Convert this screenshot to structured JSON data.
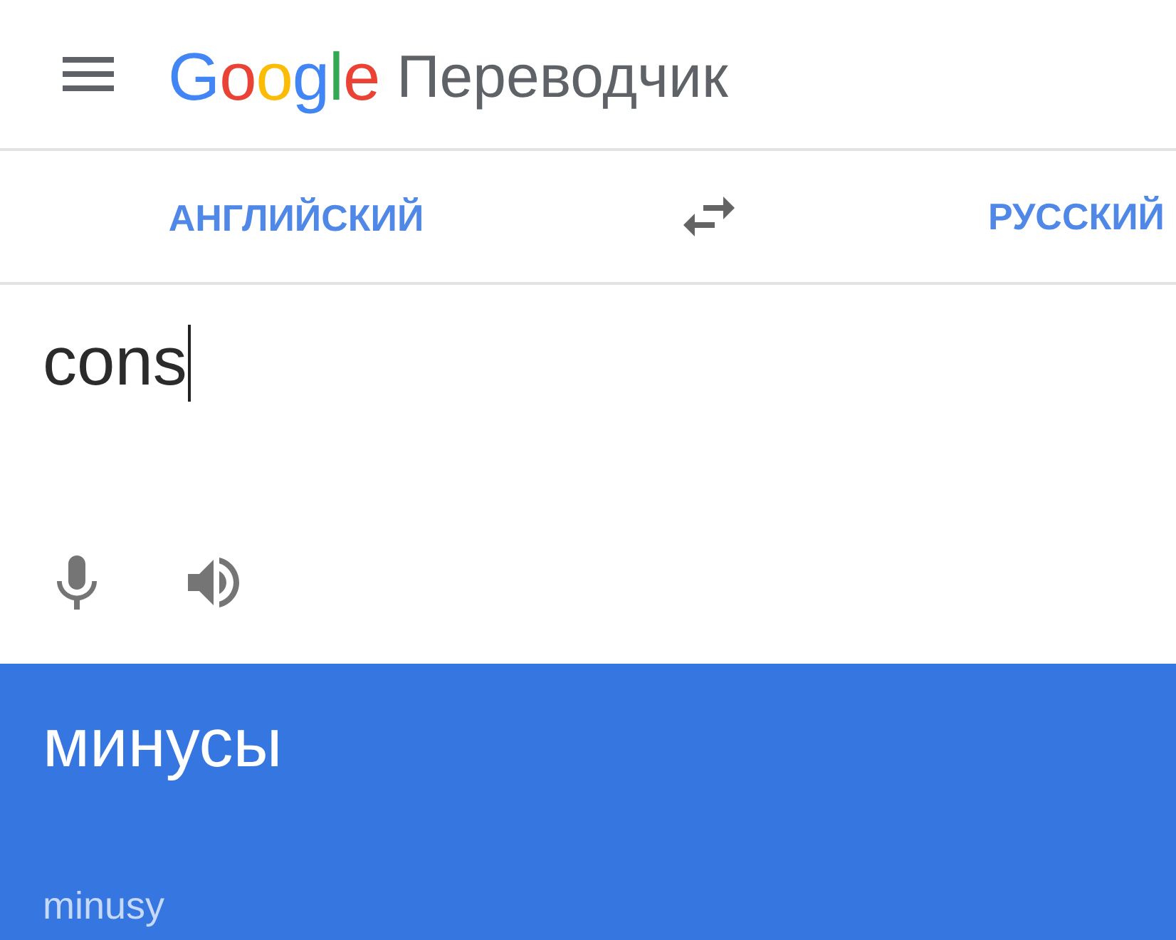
{
  "header": {
    "logo": "Google",
    "title": "Переводчик"
  },
  "languages": {
    "source": "АНГЛИЙСКИЙ",
    "target": "РУССКИЙ"
  },
  "input": {
    "value": "cons",
    "focused": true
  },
  "output": {
    "translation": "минусы",
    "transliteration": "minusy"
  }
}
